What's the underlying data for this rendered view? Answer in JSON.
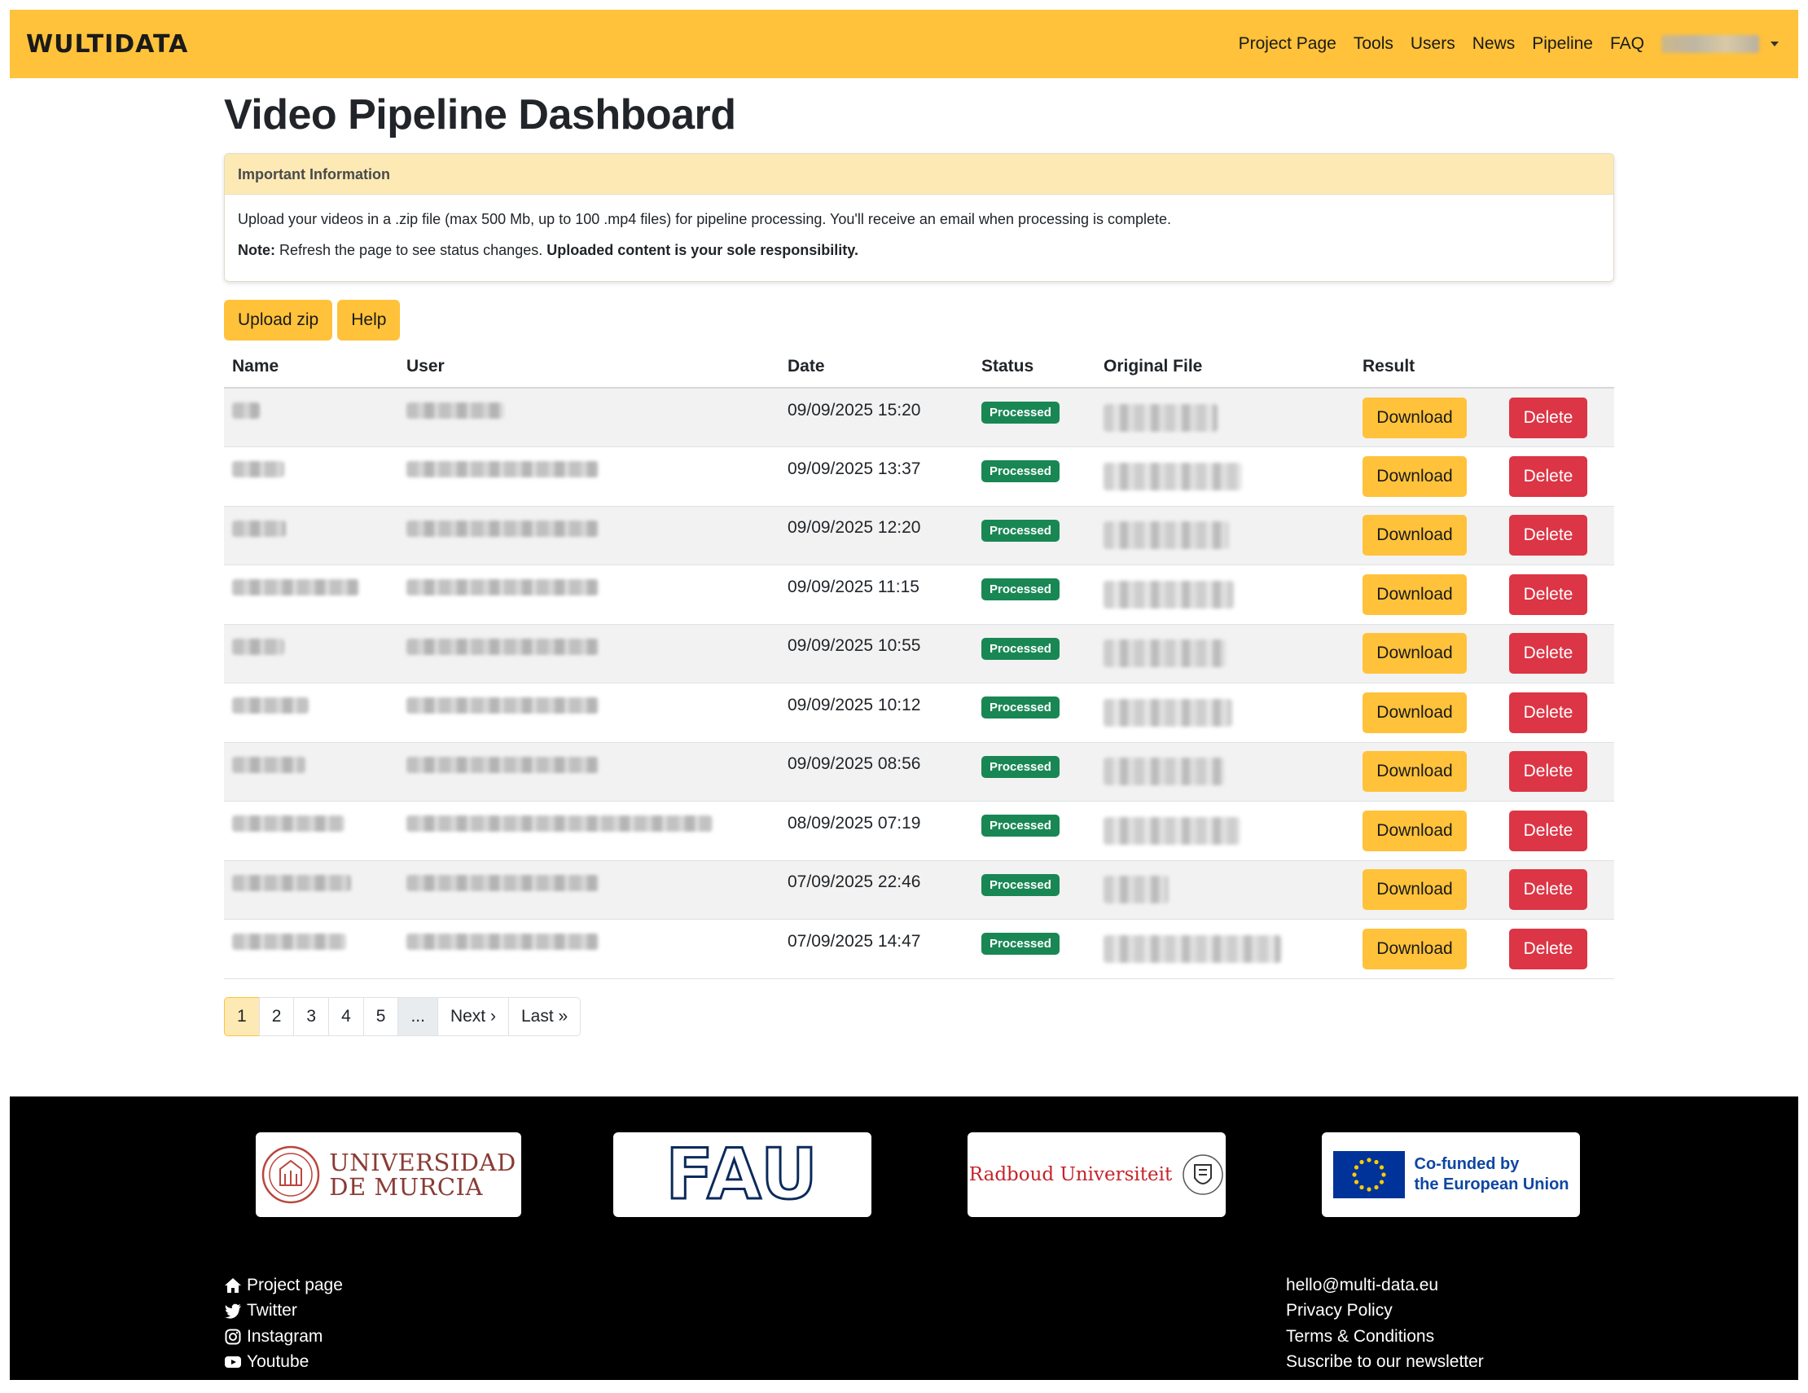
{
  "brand": "WULTIDATA",
  "nav": {
    "items": [
      "Project Page",
      "Tools",
      "Users",
      "News",
      "Pipeline",
      "FAQ"
    ],
    "user_name": ""
  },
  "page_title": "Video Pipeline Dashboard",
  "info": {
    "header": "Important Information",
    "line1": "Upload your videos in a .zip file (max 500 Mb, up to 100 .mp4 files) for pipeline processing. You'll receive an email when processing is complete.",
    "note_label": "Note:",
    "note_text": " Refresh the page to see status changes. ",
    "note_bold": "Uploaded content is your sole responsibility."
  },
  "actions": {
    "upload": "Upload zip",
    "help": "Help"
  },
  "table": {
    "columns": [
      "Name",
      "User",
      "Date",
      "Status",
      "Original File",
      "Result",
      ""
    ],
    "rows": [
      {
        "date": "09/09/2025 15:20",
        "status": "Processed",
        "download": "Download",
        "delete": "Delete"
      },
      {
        "date": "09/09/2025 13:37",
        "status": "Processed",
        "download": "Download",
        "delete": "Delete"
      },
      {
        "date": "09/09/2025 12:20",
        "status": "Processed",
        "download": "Download",
        "delete": "Delete"
      },
      {
        "date": "09/09/2025 11:15",
        "status": "Processed",
        "download": "Download",
        "delete": "Delete"
      },
      {
        "date": "09/09/2025 10:55",
        "status": "Processed",
        "download": "Download",
        "delete": "Delete"
      },
      {
        "date": "09/09/2025 10:12",
        "status": "Processed",
        "download": "Download",
        "delete": "Delete"
      },
      {
        "date": "09/09/2025 08:56",
        "status": "Processed",
        "download": "Download",
        "delete": "Delete"
      },
      {
        "date": "08/09/2025 07:19",
        "status": "Processed",
        "download": "Download",
        "delete": "Delete"
      },
      {
        "date": "07/09/2025 22:46",
        "status": "Processed",
        "download": "Download",
        "delete": "Delete"
      },
      {
        "date": "07/09/2025 14:47",
        "status": "Processed",
        "download": "Download",
        "delete": "Delete"
      }
    ]
  },
  "pagination": [
    "1",
    "2",
    "3",
    "4",
    "5",
    "...",
    "Next ›",
    "Last »"
  ],
  "footer": {
    "logos": {
      "um_line1": "UNIVERSIDAD",
      "um_line2": "DE MURCIA",
      "fau": "FAU",
      "ru": "Radboud Universiteit",
      "eu_line1": "Co-funded by",
      "eu_line2": "the European Union"
    },
    "left_links": [
      "Project page",
      "Twitter",
      "Instagram",
      "Youtube"
    ],
    "right_links": [
      "hello@multi-data.eu",
      "Privacy Policy",
      "Terms & Conditions",
      "Suscribe to our newsletter"
    ]
  },
  "colors": {
    "accent": "#ffc23a",
    "danger": "#dc3545",
    "success": "#198754",
    "footer_bg": "#000000"
  }
}
